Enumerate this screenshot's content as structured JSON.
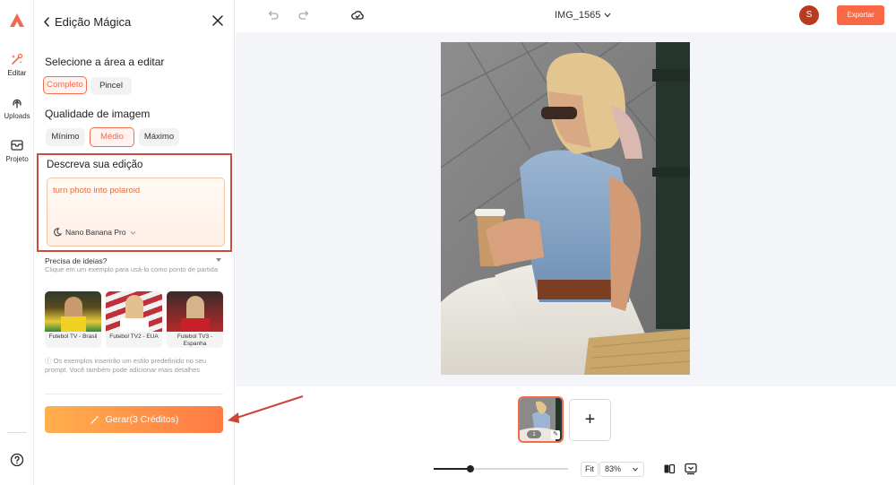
{
  "panel": {
    "back_label": "Edição Mágica",
    "area_label": "Selecione a área a editar",
    "area_options": [
      "Completo",
      "Pincel"
    ],
    "area_selected": "Completo",
    "quality_label": "Qualidade de imagem",
    "quality_options": [
      "Mínimo",
      "Médio",
      "Máximo"
    ],
    "quality_selected": "Médio",
    "describe_label": "Descreva sua edição",
    "prompt_text": "turn photo into polaroid",
    "model": "Nano Banana Pro",
    "ideas_title": "Precisa de ideias?",
    "ideas_sub": "Clique em um exemplo para usá-lo como ponto de partida",
    "examples": [
      {
        "caption": "Futebol TV - Brasil"
      },
      {
        "caption": "Futebol TV2 - EUA"
      },
      {
        "caption": "Futebol TV3 - Espanha"
      }
    ],
    "note": "Os exemplos inserirão um estilo predefinido no seu prompt. Você também pode adicionar mais detalhes",
    "generate_label": "Gerar(3 Créditos)"
  },
  "rail": {
    "items": [
      {
        "label": "Editar",
        "icon": "magic-edit-icon"
      },
      {
        "label": "Uploads",
        "icon": "upload-icon"
      },
      {
        "label": "Projeto",
        "icon": "project-icon"
      }
    ]
  },
  "topbar": {
    "file_name": "IMG_1565",
    "avatar_initial": "S",
    "export_label": "Exportar"
  },
  "canvas": {
    "thumb_number": "1",
    "add_label": "+"
  },
  "zoom": {
    "fit_label": "Fit",
    "level": "83%",
    "slider_fraction": 0.27
  },
  "colors": {
    "accent": "#f26b4c",
    "highlight_box": "#cd4a3e",
    "export": "#f86845",
    "avatar": "#b83a1f"
  }
}
